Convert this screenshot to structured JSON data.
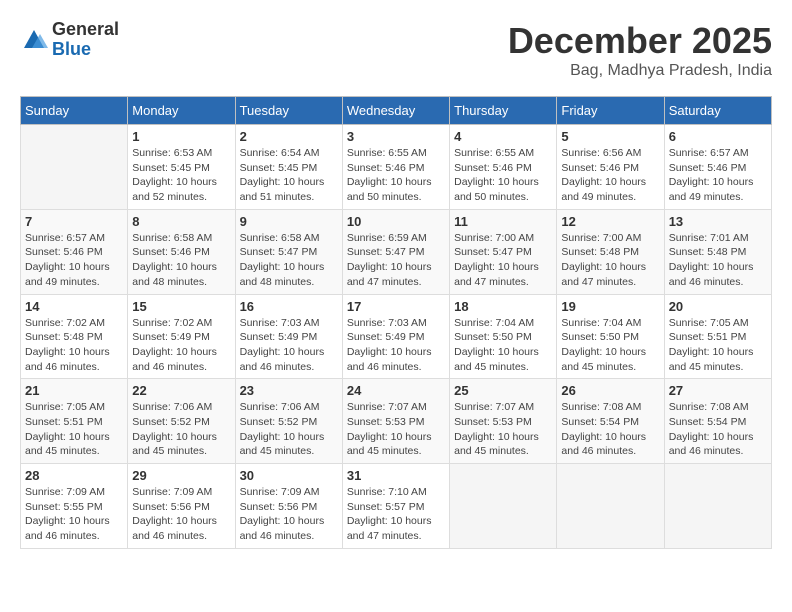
{
  "logo": {
    "general": "General",
    "blue": "Blue"
  },
  "header": {
    "month": "December 2025",
    "location": "Bag, Madhya Pradesh, India"
  },
  "weekdays": [
    "Sunday",
    "Monday",
    "Tuesday",
    "Wednesday",
    "Thursday",
    "Friday",
    "Saturday"
  ],
  "weeks": [
    [
      {
        "day": "",
        "info": ""
      },
      {
        "day": "1",
        "info": "Sunrise: 6:53 AM\nSunset: 5:45 PM\nDaylight: 10 hours\nand 52 minutes."
      },
      {
        "day": "2",
        "info": "Sunrise: 6:54 AM\nSunset: 5:45 PM\nDaylight: 10 hours\nand 51 minutes."
      },
      {
        "day": "3",
        "info": "Sunrise: 6:55 AM\nSunset: 5:46 PM\nDaylight: 10 hours\nand 50 minutes."
      },
      {
        "day": "4",
        "info": "Sunrise: 6:55 AM\nSunset: 5:46 PM\nDaylight: 10 hours\nand 50 minutes."
      },
      {
        "day": "5",
        "info": "Sunrise: 6:56 AM\nSunset: 5:46 PM\nDaylight: 10 hours\nand 49 minutes."
      },
      {
        "day": "6",
        "info": "Sunrise: 6:57 AM\nSunset: 5:46 PM\nDaylight: 10 hours\nand 49 minutes."
      }
    ],
    [
      {
        "day": "7",
        "info": "Sunrise: 6:57 AM\nSunset: 5:46 PM\nDaylight: 10 hours\nand 49 minutes."
      },
      {
        "day": "8",
        "info": "Sunrise: 6:58 AM\nSunset: 5:46 PM\nDaylight: 10 hours\nand 48 minutes."
      },
      {
        "day": "9",
        "info": "Sunrise: 6:58 AM\nSunset: 5:47 PM\nDaylight: 10 hours\nand 48 minutes."
      },
      {
        "day": "10",
        "info": "Sunrise: 6:59 AM\nSunset: 5:47 PM\nDaylight: 10 hours\nand 47 minutes."
      },
      {
        "day": "11",
        "info": "Sunrise: 7:00 AM\nSunset: 5:47 PM\nDaylight: 10 hours\nand 47 minutes."
      },
      {
        "day": "12",
        "info": "Sunrise: 7:00 AM\nSunset: 5:48 PM\nDaylight: 10 hours\nand 47 minutes."
      },
      {
        "day": "13",
        "info": "Sunrise: 7:01 AM\nSunset: 5:48 PM\nDaylight: 10 hours\nand 46 minutes."
      }
    ],
    [
      {
        "day": "14",
        "info": "Sunrise: 7:02 AM\nSunset: 5:48 PM\nDaylight: 10 hours\nand 46 minutes."
      },
      {
        "day": "15",
        "info": "Sunrise: 7:02 AM\nSunset: 5:49 PM\nDaylight: 10 hours\nand 46 minutes."
      },
      {
        "day": "16",
        "info": "Sunrise: 7:03 AM\nSunset: 5:49 PM\nDaylight: 10 hours\nand 46 minutes."
      },
      {
        "day": "17",
        "info": "Sunrise: 7:03 AM\nSunset: 5:49 PM\nDaylight: 10 hours\nand 46 minutes."
      },
      {
        "day": "18",
        "info": "Sunrise: 7:04 AM\nSunset: 5:50 PM\nDaylight: 10 hours\nand 45 minutes."
      },
      {
        "day": "19",
        "info": "Sunrise: 7:04 AM\nSunset: 5:50 PM\nDaylight: 10 hours\nand 45 minutes."
      },
      {
        "day": "20",
        "info": "Sunrise: 7:05 AM\nSunset: 5:51 PM\nDaylight: 10 hours\nand 45 minutes."
      }
    ],
    [
      {
        "day": "21",
        "info": "Sunrise: 7:05 AM\nSunset: 5:51 PM\nDaylight: 10 hours\nand 45 minutes."
      },
      {
        "day": "22",
        "info": "Sunrise: 7:06 AM\nSunset: 5:52 PM\nDaylight: 10 hours\nand 45 minutes."
      },
      {
        "day": "23",
        "info": "Sunrise: 7:06 AM\nSunset: 5:52 PM\nDaylight: 10 hours\nand 45 minutes."
      },
      {
        "day": "24",
        "info": "Sunrise: 7:07 AM\nSunset: 5:53 PM\nDaylight: 10 hours\nand 45 minutes."
      },
      {
        "day": "25",
        "info": "Sunrise: 7:07 AM\nSunset: 5:53 PM\nDaylight: 10 hours\nand 45 minutes."
      },
      {
        "day": "26",
        "info": "Sunrise: 7:08 AM\nSunset: 5:54 PM\nDaylight: 10 hours\nand 46 minutes."
      },
      {
        "day": "27",
        "info": "Sunrise: 7:08 AM\nSunset: 5:54 PM\nDaylight: 10 hours\nand 46 minutes."
      }
    ],
    [
      {
        "day": "28",
        "info": "Sunrise: 7:09 AM\nSunset: 5:55 PM\nDaylight: 10 hours\nand 46 minutes."
      },
      {
        "day": "29",
        "info": "Sunrise: 7:09 AM\nSunset: 5:56 PM\nDaylight: 10 hours\nand 46 minutes."
      },
      {
        "day": "30",
        "info": "Sunrise: 7:09 AM\nSunset: 5:56 PM\nDaylight: 10 hours\nand 46 minutes."
      },
      {
        "day": "31",
        "info": "Sunrise: 7:10 AM\nSunset: 5:57 PM\nDaylight: 10 hours\nand 47 minutes."
      },
      {
        "day": "",
        "info": ""
      },
      {
        "day": "",
        "info": ""
      },
      {
        "day": "",
        "info": ""
      }
    ]
  ]
}
